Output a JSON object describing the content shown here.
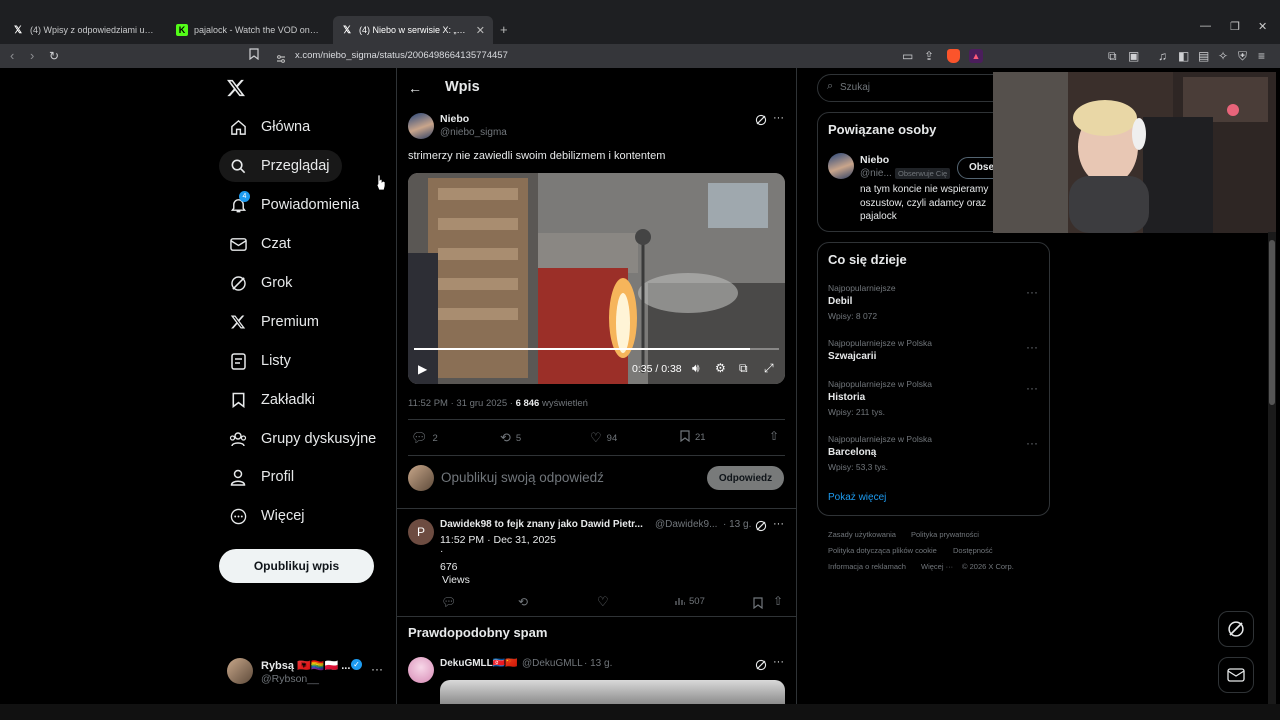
{
  "browser": {
    "tabs": [
      {
        "title": "(4) Wpisy z odpowiedziami użytkow..."
      },
      {
        "title": "pajalock - Watch the VOD on Kick"
      },
      {
        "title": "(4) Niebo w serwisie X: „strimerz..."
      }
    ],
    "url": "x.com/niebo_sigma/status/2006498664135774457"
  },
  "nav": {
    "items": [
      {
        "label": "Główna",
        "icon": "home-icon"
      },
      {
        "label": "Przeglądaj",
        "icon": "search-icon"
      },
      {
        "label": "Powiadomienia",
        "icon": "bell-icon",
        "badge": "4"
      },
      {
        "label": "Czat",
        "icon": "mail-icon"
      },
      {
        "label": "Grok",
        "icon": "grok-icon"
      },
      {
        "label": "Premium",
        "icon": "x-logo-icon"
      },
      {
        "label": "Listy",
        "icon": "list-icon"
      },
      {
        "label": "Zakładki",
        "icon": "bookmark-icon"
      },
      {
        "label": "Grupy dyskusyjne",
        "icon": "communities-icon"
      },
      {
        "label": "Profil",
        "icon": "profile-icon"
      },
      {
        "label": "Więcej",
        "icon": "more-circle-icon"
      }
    ],
    "post_button": "Opublikuj wpis",
    "account": {
      "name": "Rybsą 🇦🇱🏳️‍🌈🇵🇱 ...",
      "handle": "@Rybson__"
    }
  },
  "main": {
    "header_title": "Wpis",
    "post": {
      "author": "Niebo",
      "handle": "@niebo_sigma",
      "text": "strimerzy nie zawiedli swoim debilizmem i kontentem",
      "video_time": "0:35 / 0:38",
      "video_progress": 0.92,
      "meta_time": "11:52 PM · 31 gru 2025 · ",
      "views_count": "6 846",
      "views_label": " wyświetleń",
      "replies": "2",
      "reposts": "5",
      "likes": "94",
      "bookmarks": "21"
    },
    "reply_box": {
      "placeholder": "Opublikuj swoją odpowiedź",
      "button": "Odpowiedz"
    },
    "reply1": {
      "avatar_letter": "P",
      "author": "Dawidek98 to fejk znany jako Dawid Pietr...",
      "handle": "@Dawidek9...",
      "age": "· 13 g.",
      "line1": "11:52 PM · Dec 31, 2025",
      "line2": "·",
      "line3": "676",
      "line4": "Views",
      "views": "507"
    },
    "spam_header": "Prawdopodobny spam",
    "reply2": {
      "author": "DekuGMLL🇰🇵🇨🇳",
      "handle": "@DekuGMLL",
      "age": "· 13 g."
    }
  },
  "right": {
    "search_placeholder": "Szukaj",
    "related": {
      "title": "Powiązane osoby",
      "name": "Niebo",
      "handle": "@nie...",
      "follows_you": "Obserwuje Cię",
      "follow_button": "Obse",
      "bio": "na tym koncie nie wspieramy oszustow, czyli adamcy oraz pajalock"
    },
    "trends": {
      "title": "Co się dzieje",
      "items": [
        {
          "context": "Najpopularniejsze",
          "name": "Debil",
          "posts": "Wpisy: 8 072"
        },
        {
          "context": "Najpopularniejsze w Polska",
          "name": "Szwajcarii",
          "posts": ""
        },
        {
          "context": "Najpopularniejsze w Polska",
          "name": "Historia",
          "posts": "Wpisy: 211 tys."
        },
        {
          "context": "Najpopularniejsze w Polska",
          "name": "Barceloną",
          "posts": "Wpisy: 53,3 tys."
        }
      ],
      "show_more": "Pokaż więcej"
    },
    "footer": {
      "links": [
        "Zasady użytkowania",
        "Polityka prywatności",
        "Polityka dotycząca plików cookie",
        "Dostępność",
        "Informacja o reklamach",
        "Więcej ···",
        "© 2026 X Corp."
      ]
    }
  },
  "colors": {
    "accent": "#1d9bf0",
    "bg": "#000000",
    "border": "#2f3336",
    "muted": "#71767b"
  }
}
